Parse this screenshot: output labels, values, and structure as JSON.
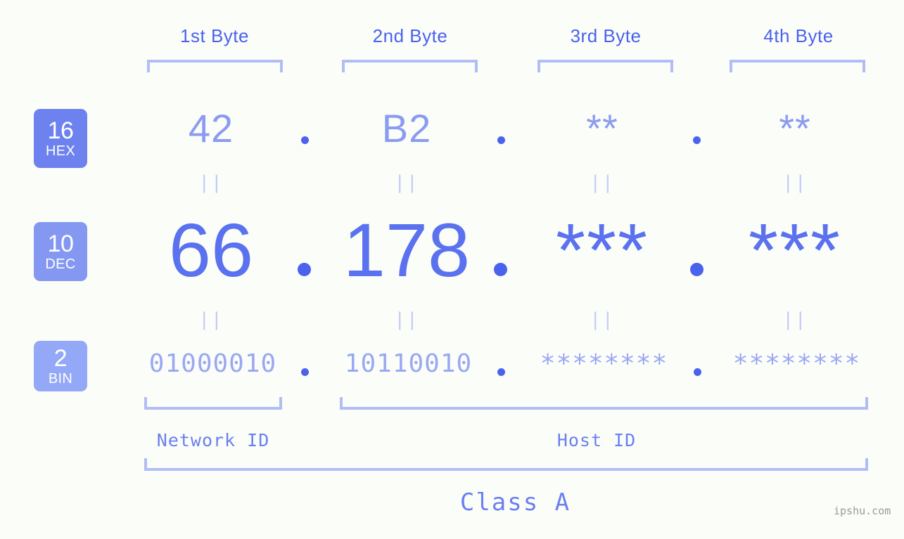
{
  "theme": {
    "background": "#fbfdf9",
    "accent_strong": "#4a62ed",
    "accent": "#5a72ef",
    "accent_light": "#8b9bf0",
    "accent_lighter": "#9aa8f2",
    "bracket": "#b3bdf5",
    "eq_mark": "#c3cbf7",
    "badge_hex": "#6d82ee",
    "badge_dec": "#8498f2",
    "badge_bin": "#93a8f6",
    "watermark": "#9b9b9b"
  },
  "byte_headers": [
    {
      "label": "1st Byte"
    },
    {
      "label": "2nd Byte"
    },
    {
      "label": "3rd Byte"
    },
    {
      "label": "4th Byte"
    }
  ],
  "rows": [
    {
      "badge_number": "16",
      "badge_name": "HEX",
      "values": [
        "42",
        "B2",
        "**",
        "**"
      ]
    },
    {
      "badge_number": "10",
      "badge_name": "DEC",
      "values": [
        "66",
        "178",
        "***",
        "***"
      ]
    },
    {
      "badge_number": "2",
      "badge_name": "BIN",
      "values": [
        "01000010",
        "10110010",
        "********",
        "********"
      ]
    }
  ],
  "separators": {
    "hex_dots": [
      ".",
      ".",
      "."
    ],
    "dec_dots": [
      ".",
      ".",
      "."
    ],
    "bin_dots": [
      ".",
      ".",
      "."
    ]
  },
  "equivalence_mark": "||",
  "segments": {
    "network_id": "Network ID",
    "host_id": "Host ID"
  },
  "class_label": "Class A",
  "watermark": "ipshu.com"
}
